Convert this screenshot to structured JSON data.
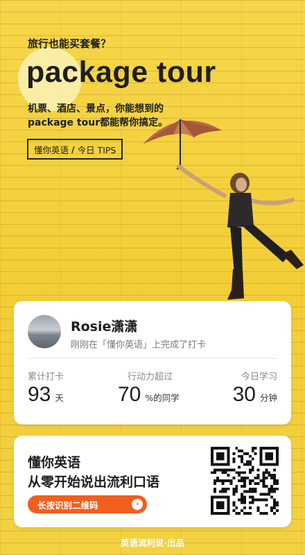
{
  "header": {
    "question": "旅行也能买套餐？",
    "title": "package tour",
    "desc_line1": "机票、酒店、景点，你能想到的",
    "desc_line2": "package tour都能帮你搞定。",
    "tips_brand": "懂你英语",
    "tips_sep": "/",
    "tips_label": "今日 TIPS"
  },
  "profile": {
    "name": "Rosie潇潇",
    "status": "刚刚在「懂你英语」上完成了打卡",
    "stats": [
      {
        "label": "累计打卡",
        "value": "93",
        "unit": "天"
      },
      {
        "label": "行动力超过",
        "value": "70",
        "unit": "%的同学"
      },
      {
        "label": "今日学习",
        "value": "30",
        "unit": "分钟"
      }
    ]
  },
  "brand": {
    "name": "懂你英语",
    "slogan": "从零开始说出流利口语",
    "cta": "长按识别二维码",
    "cta_icon": "chevron-right-icon"
  },
  "footer": {
    "text": "英语流利说·出品"
  },
  "colors": {
    "background": "#f3d03d",
    "accent": "#f15f1e",
    "card": "#ffffff",
    "text": "#1e1e1e"
  }
}
